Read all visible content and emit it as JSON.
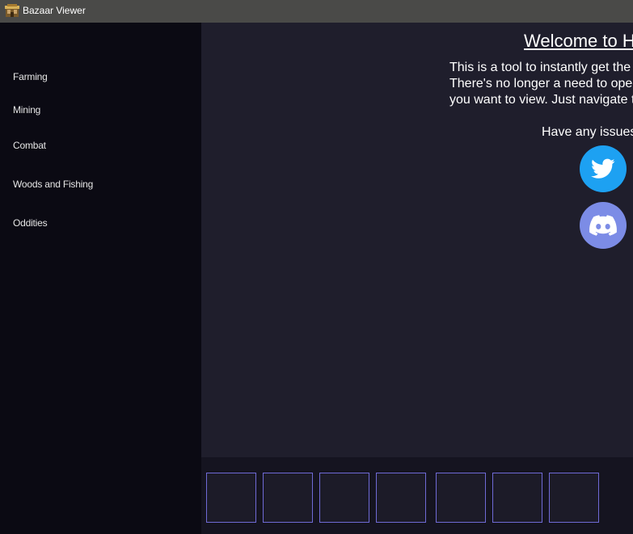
{
  "window": {
    "title": "Bazaar Viewer",
    "icon": "bazaar-app-icon"
  },
  "sidebar": {
    "items": [
      {
        "label": "Farming"
      },
      {
        "label": "Mining"
      },
      {
        "label": "Combat"
      },
      {
        "label": "Woods and Fishing"
      },
      {
        "label": "Oddities"
      }
    ]
  },
  "main": {
    "welcome_title": "Welcome to H",
    "intro_lines": [
      "This is a tool to instantly get the I",
      "There's no longer a need to open",
      "you want to view. Just navigate t"
    ],
    "issues_text": "Have any issues",
    "social": [
      {
        "icon": "twitter-icon",
        "color": "#1da1f2"
      },
      {
        "icon": "discord-icon",
        "color": "#7c8ce6"
      }
    ]
  },
  "bottom_bar": {
    "slot_count": 7,
    "slot_border_color": "#6f6ad6"
  },
  "colors": {
    "sidebar_bg": "#0b0a13",
    "main_bg": "#1f1e2c",
    "titlebar_bg": "#4a4a48",
    "text": "#ffffff"
  }
}
